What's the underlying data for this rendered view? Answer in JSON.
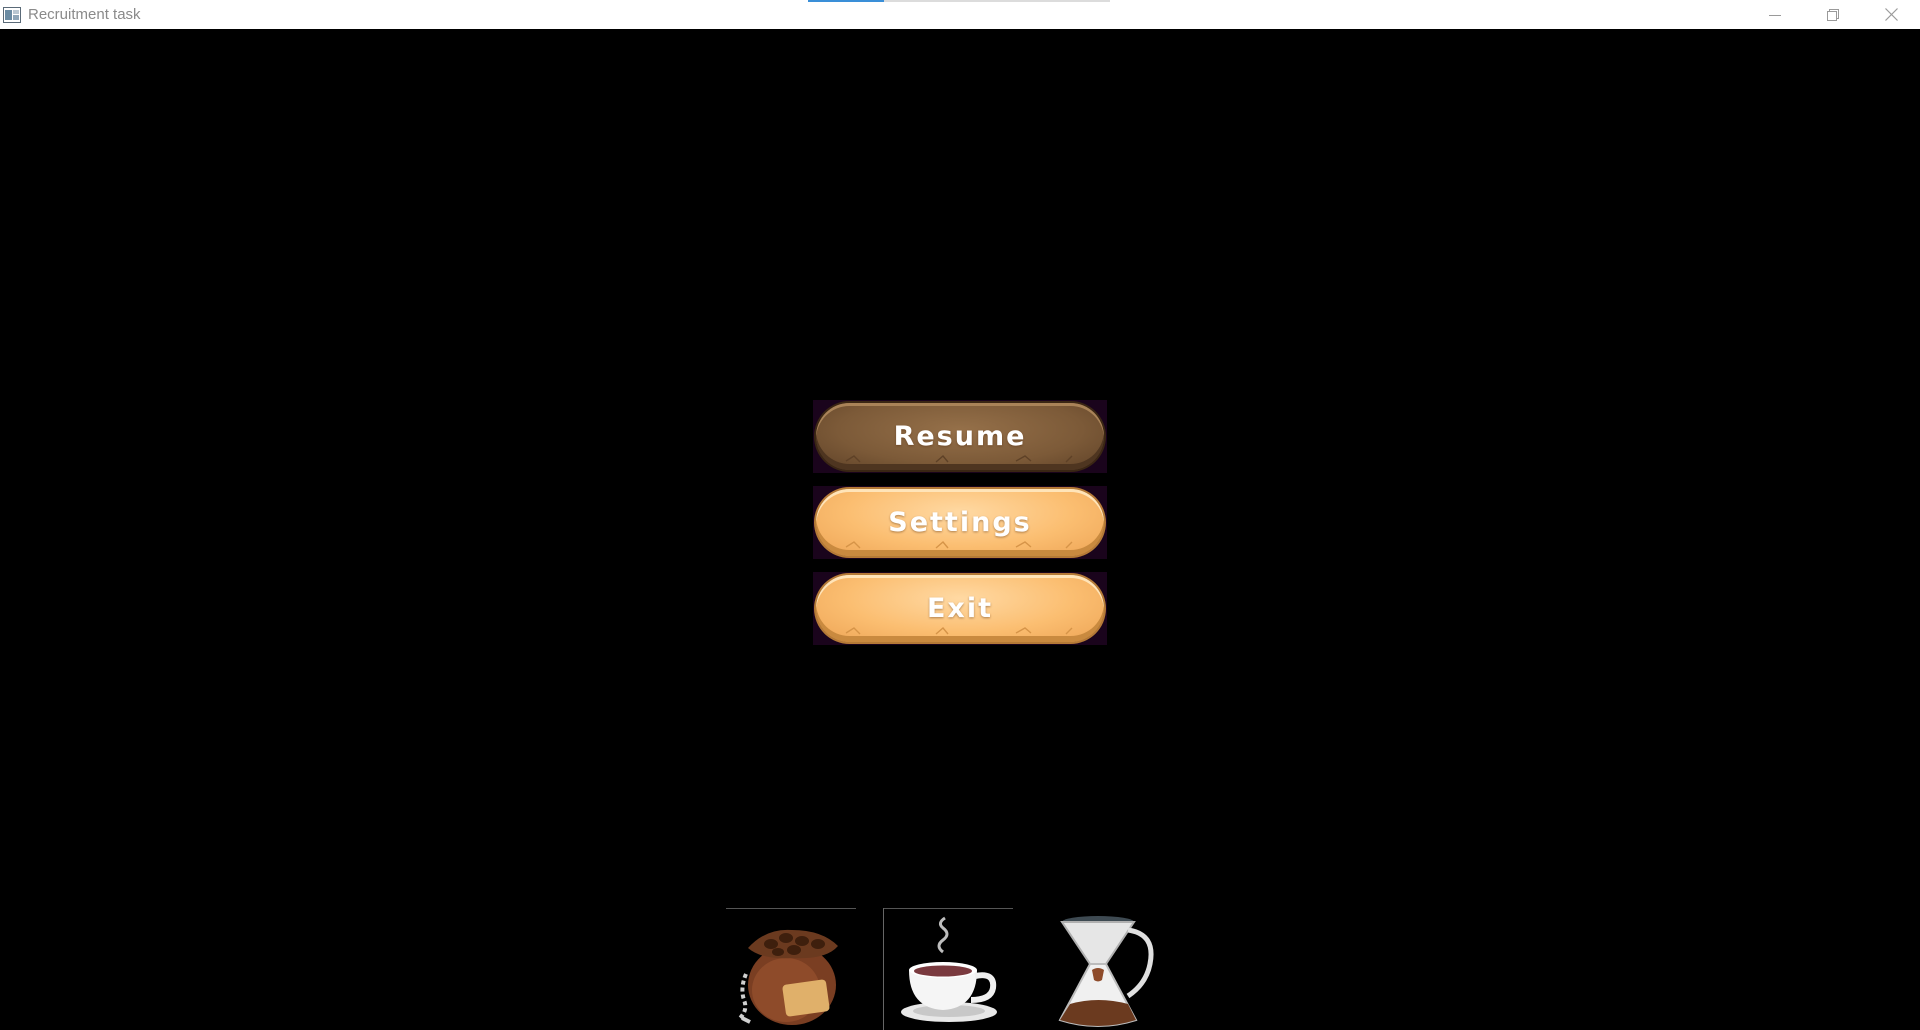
{
  "window": {
    "title": "Recruitment task",
    "loading_progress": 0.25
  },
  "menu": {
    "buttons": [
      {
        "label": "Resume",
        "state": "highlighted",
        "color": "#7c5a38"
      },
      {
        "label": "Settings",
        "state": "normal",
        "color": "#fbbe71"
      },
      {
        "label": "Exit",
        "state": "normal",
        "color": "#fbbe71"
      }
    ]
  },
  "hotbar": {
    "slots": [
      {
        "item": "coffee-bean-sack-icon",
        "selected": false
      },
      {
        "item": "hot-coffee-cup-icon",
        "selected": true
      },
      {
        "item": "pour-over-coffee-maker-icon",
        "selected": false
      }
    ]
  },
  "colors": {
    "background": "#000000",
    "titlebar": "#ffffff",
    "accent": "#3a8fd8"
  }
}
